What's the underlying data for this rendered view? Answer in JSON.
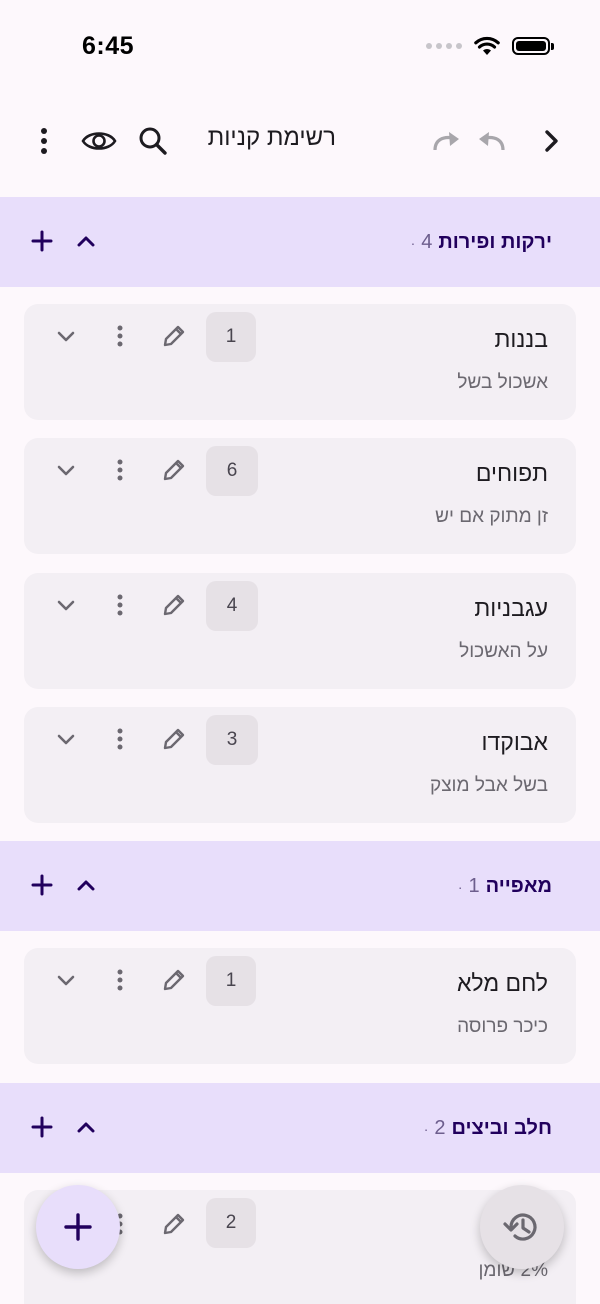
{
  "status": {
    "time": "6:45"
  },
  "app_bar": {
    "title": "רשימת קניות"
  },
  "colors": {
    "header_bg": "#e8defb",
    "card_bg": "#f3eff4",
    "accent": "#21005d"
  },
  "categories": [
    {
      "name": "ירקות ופירות",
      "count": "4",
      "items": [
        {
          "name": "בננות",
          "desc": "אשכול בשל",
          "qty": "1"
        },
        {
          "name": "תפוחים",
          "desc": "זן מתוק אם יש",
          "qty": "6"
        },
        {
          "name": "עגבניות",
          "desc": "על האשכול",
          "qty": "4"
        },
        {
          "name": "אבוקדו",
          "desc": "בשל אבל מוצק",
          "qty": "3"
        }
      ]
    },
    {
      "name": "מאפייה",
      "count": "1",
      "items": [
        {
          "name": "לחם מלא",
          "desc": "כיכר פרוסה",
          "qty": "1"
        }
      ]
    },
    {
      "name": "חלב וביצים",
      "count": "2",
      "items": [
        {
          "name": "",
          "desc": "2% שומן",
          "qty": "2"
        }
      ]
    }
  ],
  "icons": {
    "app_bar": [
      "more-vert-icon",
      "eye-icon",
      "search-icon",
      "redo-icon",
      "undo-icon",
      "chevron-right-icon"
    ],
    "category": [
      "add-icon",
      "chevron-up-icon"
    ],
    "item": [
      "chevron-down-icon",
      "more-vert-icon",
      "pencil-icon"
    ],
    "fabs": [
      "add-icon",
      "history-icon"
    ]
  }
}
